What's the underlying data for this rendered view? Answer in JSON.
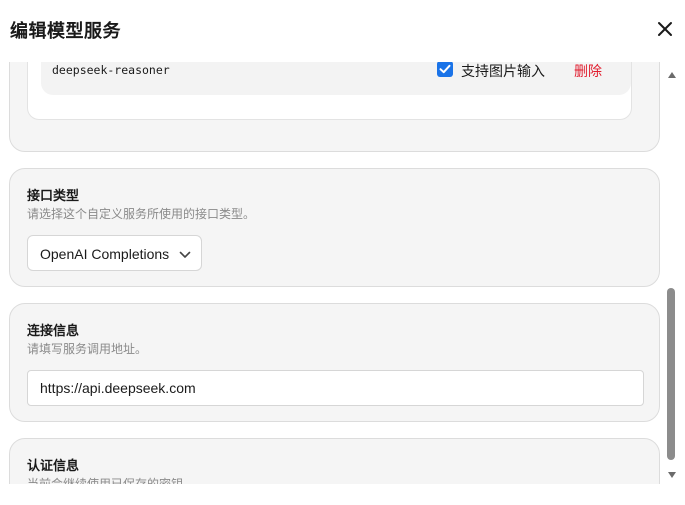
{
  "dialog": {
    "title": "编辑模型服务",
    "close_icon": "close-icon"
  },
  "models": {
    "items": [
      {
        "name": "deepseek-reasoner",
        "supports_image_label": "支持图片输入",
        "supports_image": true,
        "delete_label": "删除"
      }
    ]
  },
  "interface_type": {
    "title": "接口类型",
    "description": "请选择这个自定义服务所使用的接口类型。",
    "selected": "OpenAI Completions"
  },
  "connection": {
    "title": "连接信息",
    "description": "请填写服务调用地址。",
    "url": "https://api.deepseek.com"
  },
  "auth": {
    "title": "认证信息",
    "description": "当前会继续使用已保存的密钥。"
  },
  "colors": {
    "accent": "#1a73e8",
    "danger": "#e11d2e",
    "card_bg": "#f5f5f5"
  }
}
